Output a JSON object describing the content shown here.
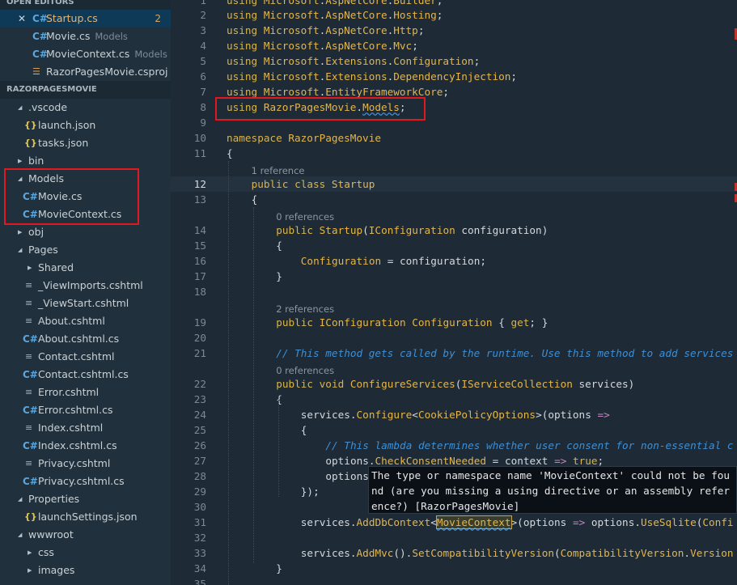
{
  "sidebar": {
    "open_editors_header": "OPEN EDITORS",
    "open_editors": [
      {
        "name": "Startup.cs",
        "sub": "",
        "badge": "2"
      },
      {
        "name": "Movie.cs",
        "sub": "Models",
        "badge": ""
      },
      {
        "name": "MovieContext.cs",
        "sub": "Models",
        "badge": ""
      },
      {
        "name": "RazorPagesMovie.csproj",
        "sub": "",
        "badge": ""
      }
    ],
    "project_header": "RAZORPAGESMOVIE",
    "tree": [
      {
        "label": ".vscode",
        "icon": "chevron-down"
      },
      {
        "label": "launch.json",
        "icon": "json"
      },
      {
        "label": "tasks.json",
        "icon": "json"
      },
      {
        "label": "bin",
        "icon": "chevron-right"
      },
      {
        "label": "Models",
        "icon": "chevron-down"
      },
      {
        "label": "Movie.cs",
        "icon": "csharp"
      },
      {
        "label": "MovieContext.cs",
        "icon": "csharp"
      },
      {
        "label": "obj",
        "icon": "chevron-right"
      },
      {
        "label": "Pages",
        "icon": "chevron-down"
      },
      {
        "label": "Shared",
        "icon": "chevron-right"
      },
      {
        "label": "_ViewImports.cshtml",
        "icon": "list"
      },
      {
        "label": "_ViewStart.cshtml",
        "icon": "list"
      },
      {
        "label": "About.cshtml",
        "icon": "list"
      },
      {
        "label": "About.cshtml.cs",
        "icon": "csharp"
      },
      {
        "label": "Contact.cshtml",
        "icon": "list"
      },
      {
        "label": "Contact.cshtml.cs",
        "icon": "csharp"
      },
      {
        "label": "Error.cshtml",
        "icon": "list"
      },
      {
        "label": "Error.cshtml.cs",
        "icon": "csharp"
      },
      {
        "label": "Index.cshtml",
        "icon": "list"
      },
      {
        "label": "Index.cshtml.cs",
        "icon": "csharp"
      },
      {
        "label": "Privacy.cshtml",
        "icon": "list"
      },
      {
        "label": "Privacy.cshtml.cs",
        "icon": "csharp"
      },
      {
        "label": "Properties",
        "icon": "chevron-down"
      },
      {
        "label": "launchSettings.json",
        "icon": "json"
      },
      {
        "label": "wwwroot",
        "icon": "chevron-down"
      },
      {
        "label": "css",
        "icon": "chevron-right"
      },
      {
        "label": "images",
        "icon": "chevron-right"
      }
    ]
  },
  "editor": {
    "lens": {
      "class_refs": "1 reference",
      "ctor_refs": "0 references",
      "prop_refs": "2 references",
      "configure_refs": "0 references"
    },
    "lines": {
      "l1": "using Microsoft.AspNetCore.Builder;",
      "l2": "using Microsoft.AspNetCore.Hosting;",
      "l3": "using Microsoft.AspNetCore.Http;",
      "l4": "using Microsoft.AspNetCore.Mvc;",
      "l5": "using Microsoft.Extensions.Configuration;",
      "l6": "using Microsoft.Extensions.DependencyInjection;",
      "l7": "using Microsoft.EntityFrameworkCore;",
      "l8": "using RazorPagesMovie.Models;",
      "l10": "namespace RazorPagesMovie",
      "l11": "{",
      "l12": "public class Startup",
      "l13": "{",
      "l14": "public Startup(IConfiguration configuration)",
      "l15": "{",
      "l16": "Configuration = configuration;",
      "l17": "}",
      "l19": "public IConfiguration Configuration { get; }",
      "l21": "// This method gets called by the runtime. Use this method to add services",
      "l22": "public void ConfigureServices(IServiceCollection services)",
      "l23": "{",
      "l24": "services.Configure<CookiePolicyOptions>(options =>",
      "l25": "{",
      "l26": "// This lambda determines whether user consent for non-essential c",
      "l27": "options.CheckConsentNeeded = context => true;",
      "l28": "options",
      "l29": "});",
      "l31": "services.AddDbContext<MovieContext>(options => options.UseSqlite(Confi",
      "l33": "services.AddMvc().SetCompatibilityVersion(CompatibilityVersion.Version",
      "l34": "}"
    },
    "line_numbers": [
      "1",
      "2",
      "3",
      "4",
      "5",
      "6",
      "7",
      "8",
      "9",
      "10",
      "11",
      "12",
      "13",
      "14",
      "15",
      "16",
      "17",
      "18",
      "19",
      "20",
      "21",
      "22",
      "23",
      "24",
      "25",
      "26",
      "27",
      "28",
      "29",
      "30",
      "31",
      "32",
      "33",
      "34",
      "35"
    ],
    "tooltip": "The type or namespace name 'MovieContext' could not be fou\nnd (are you missing a using directive or an assembly refer\nence?) [RazorPagesMovie]"
  },
  "colors": {
    "sidebar_bg": "#20303d",
    "editor_bg": "#1e2a35",
    "keyword": "#d8b44a",
    "comment": "#3d8fd6",
    "annotation_red": "#e0191f"
  }
}
